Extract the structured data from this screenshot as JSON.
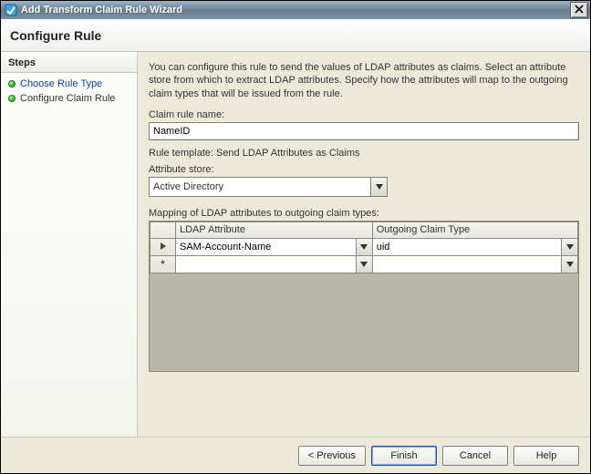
{
  "window": {
    "title": "Add Transform Claim Rule Wizard"
  },
  "header": {
    "page_title": "Configure Rule"
  },
  "sidebar": {
    "section_label": "Steps",
    "items": [
      {
        "label": "Choose Rule Type",
        "state": "link"
      },
      {
        "label": "Configure Claim Rule",
        "state": "current"
      }
    ]
  },
  "content": {
    "intro": "You can configure this rule to send the values of LDAP attributes as claims. Select an attribute store from which to extract LDAP attributes. Specify how the attributes will map to the outgoing claim types that will be issued from the rule.",
    "claim_rule_name_label": "Claim rule name:",
    "claim_rule_name_value": "NameID",
    "rule_template_line": "Rule template: Send LDAP Attributes as Claims",
    "attribute_store_label": "Attribute store:",
    "attribute_store_value": "Active Directory",
    "mapping_label": "Mapping of LDAP attributes to outgoing claim types:",
    "mapping_table": {
      "columns": [
        {
          "header": "LDAP Attribute"
        },
        {
          "header": "Outgoing Claim Type"
        }
      ],
      "rows": [
        {
          "row_header": "arrow",
          "ldap_attribute": "SAM-Account-Name",
          "outgoing_claim_type": "uid"
        },
        {
          "row_header": "star",
          "ldap_attribute": "",
          "outgoing_claim_type": ""
        }
      ]
    }
  },
  "footer": {
    "previous": "< Previous",
    "finish": "Finish",
    "cancel": "Cancel",
    "help": "Help"
  }
}
